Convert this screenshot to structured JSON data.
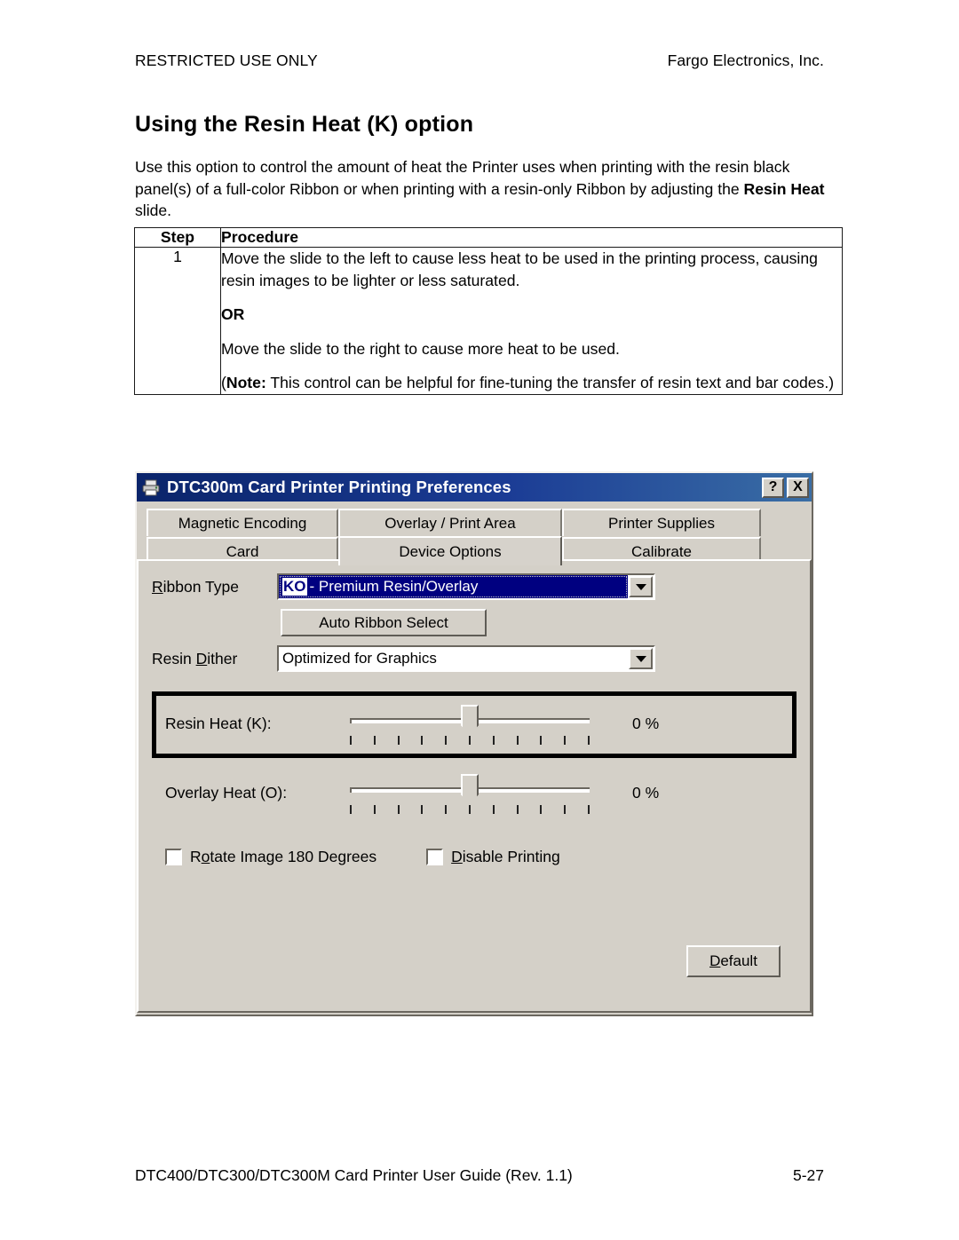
{
  "page_header": {
    "left": "RESTRICTED USE ONLY",
    "right": "Fargo Electronics, Inc."
  },
  "section_title": "Using the Resin Heat (K) option",
  "intro": {
    "part1": "Use this option to control the amount of heat the Printer uses when printing with the resin black panel(s) of a full-color Ribbon or when printing with a resin-only Ribbon by adjusting the ",
    "bold": "Resin Heat",
    "part2": " slide."
  },
  "procedure_table": {
    "headers": [
      "Step",
      "Procedure"
    ],
    "rows": [
      {
        "step": "1",
        "paragraphs": [
          "Move the slide to the left to cause less heat to be used in the printing process, causing resin images to be lighter or less saturated.",
          "OR",
          "Move the slide to the right to cause more heat to be used."
        ],
        "note_prefix": "(",
        "note_bold": "Note:",
        "note_text": "  This control can be helpful for fine-tuning the transfer of resin text and bar codes.)"
      }
    ]
  },
  "dialog": {
    "title": "DTC300m Card Printer Printing Preferences",
    "titlebar_buttons": {
      "help": "?",
      "close": "X"
    },
    "tabs_row1": [
      "Magnetic Encoding",
      "Overlay / Print Area",
      "Printer Supplies"
    ],
    "tabs_row2": [
      "Card",
      "Device Options",
      "Calibrate"
    ],
    "active_tab": "Device Options",
    "ribbon_type": {
      "label_pre": "R",
      "label_underlined": "R",
      "label": "Ribbon Type",
      "value_prefix": "KO",
      "value": " - Premium Resin/Overlay"
    },
    "auto_ribbon_select": "Auto Ribbon Select",
    "resin_dither": {
      "label": "Resin Dither",
      "value": "Optimized for Graphics"
    },
    "resin_heat": {
      "label": "Resin Heat  (K):",
      "value": "0 %",
      "tick_count": 11,
      "thumb_percent": 50
    },
    "overlay_heat": {
      "label": "Overlay Heat  (O):",
      "value": "0 %",
      "tick_count": 11,
      "thumb_percent": 50
    },
    "checkboxes": [
      {
        "label": "Rotate Image 180 Degrees",
        "checked": false
      },
      {
        "label": "Disable Printing",
        "checked": false
      }
    ],
    "default_button": "Default",
    "colors": {
      "titlebar_start": "#0a246a",
      "titlebar_end": "#3a6ea5",
      "face": "#d4d0c8",
      "selection": "#000080"
    }
  },
  "page_footer": {
    "left": "DTC400/DTC300/DTC300M Card Printer User Guide (Rev. 1.1)",
    "right": "5-27"
  }
}
